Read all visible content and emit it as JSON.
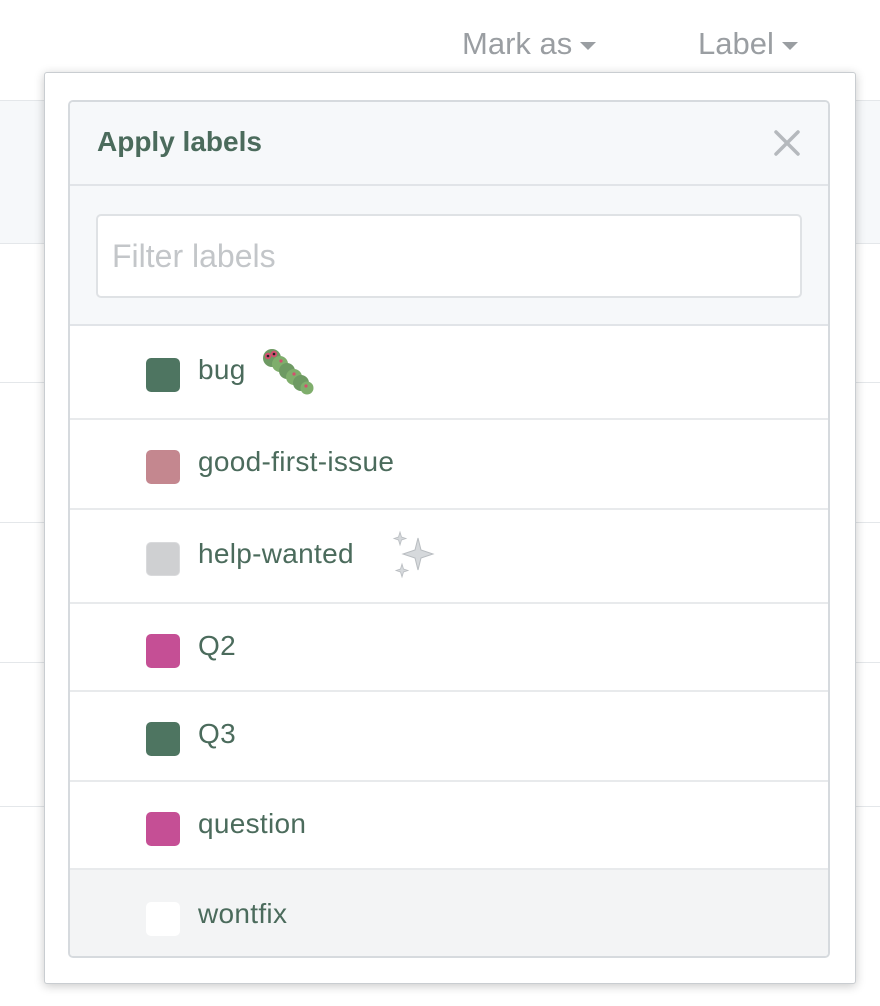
{
  "toolbar": {
    "mark_as_label": "Mark as",
    "label_label": "Label"
  },
  "menu": {
    "title": "Apply labels",
    "filter_placeholder": "Filter labels",
    "filter_value": ""
  },
  "labels": [
    {
      "name": "bug",
      "color": "#4e7561",
      "emoji": "caterpillar-icon"
    },
    {
      "name": "good-first-issue",
      "color": "#c4878f",
      "emoji": ""
    },
    {
      "name": "help-wanted",
      "color": "#cfd0d2",
      "emoji": "sparkles-icon"
    },
    {
      "name": "Q2",
      "color": "#c54f95",
      "emoji": ""
    },
    {
      "name": "Q3",
      "color": "#4e7561",
      "emoji": ""
    },
    {
      "name": "question",
      "color": "#c54f95",
      "emoji": ""
    },
    {
      "name": "wontfix",
      "color": "#ffffff",
      "emoji": ""
    }
  ],
  "colors": {
    "text": "#4b6b5c",
    "muted": "#9a9ea2",
    "header_bg": "#f6f8fa",
    "hover_bg": "#f3f4f5"
  }
}
